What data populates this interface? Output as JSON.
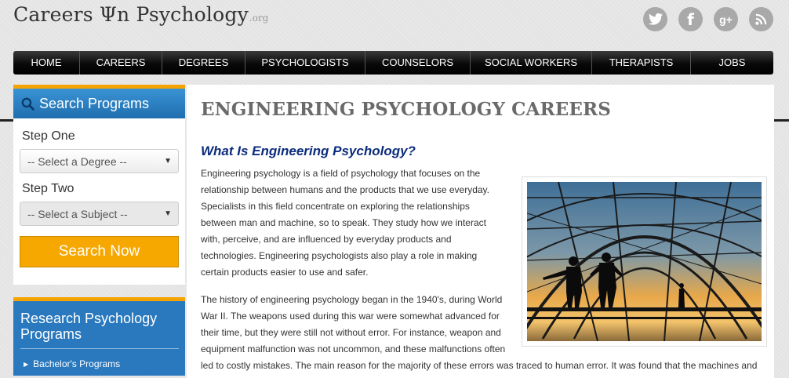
{
  "logo": {
    "main": "Careers Ψn Psychology",
    "suffix": ".org"
  },
  "social": [
    {
      "name": "twitter",
      "icon": "twitter-icon"
    },
    {
      "name": "facebook",
      "icon": "facebook-icon",
      "glyph": "f"
    },
    {
      "name": "google-plus",
      "icon": "google-plus-icon",
      "glyph": "g+"
    },
    {
      "name": "rss",
      "icon": "rss-icon"
    }
  ],
  "nav": {
    "items": [
      "HOME",
      "CAREERS",
      "DEGREES",
      "PSYCHOLOGISTS",
      "COUNSELORS",
      "SOCIAL WORKERS",
      "THERAPISTS",
      "JOBS"
    ]
  },
  "sidebar": {
    "search_title": "Search Programs",
    "step_one": "Step One",
    "degree_select": "-- Select a Degree --",
    "step_two": "Step Two",
    "subject_select": "-- Select a Subject --",
    "search_button": "Search Now",
    "research_title": "Research Psychology Programs",
    "research_link": "Bachelor's Programs"
  },
  "main": {
    "title": "ENGINEERING PSYCHOLOGY CAREERS",
    "subtitle": "What Is Engineering Psychology?",
    "para1": "Engineering psychology is a field of psychology that focuses on the relationship between humans and the products that we use everyday. Specialists in this field concentrate on exploring the relationships between man and machine, so to speak. They study how we interact with, perceive, and are influenced by everyday products and technologies. Engineering psychologists also play a role in making certain products easier to use and safer.",
    "para2_line1": "The history of engineering psychology began in the 1940's, during World",
    "para2_line2": "War II. The weapons used during this war were somewhat advanced for",
    "para2_line3": "their time, but they were still not without error. For instance, weapon and",
    "para2_line4": "equipment malfunction was not uncommon, and these malfunctions often",
    "para2_line5": "led to costly mistakes. The main reason for the majority of these errors was traced to human error. It was found that the machines and"
  },
  "colors": {
    "accent_orange": "#f6a700",
    "nav_black": "#0a0a0a",
    "sidebar_blue": "#2a79be",
    "subtitle_blue": "#0c2c7c"
  }
}
